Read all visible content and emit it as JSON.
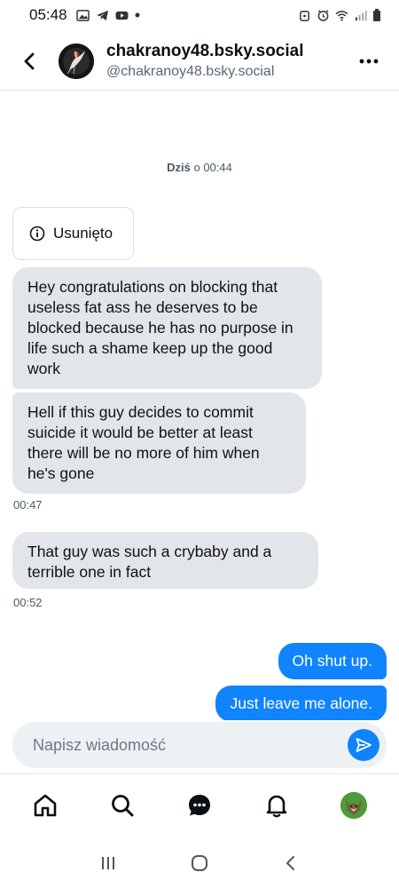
{
  "status_bar": {
    "time": "05:48",
    "left_icons": [
      "gallery-icon",
      "telegram-icon",
      "youtube-icon",
      "dot-icon"
    ],
    "right_icons": [
      "alarm-icon",
      "clock-icon",
      "wifi-icon",
      "signal-icon",
      "battery-icon"
    ]
  },
  "header": {
    "display_name": "chakranoy48.bsky.social",
    "handle": "@chakranoy48.bsky.social",
    "back_icon": "chevron-left-icon",
    "more_icon": "more-horizontal-icon"
  },
  "conversation": {
    "date_label_bold": "Dziś",
    "date_label_rest": " o 00:44",
    "deleted_label": "Usunięto",
    "messages_received": [
      {
        "text": "Hey congratulations on blocking that useless fat ass he deserves to be blocked because he has no purpose in life such a shame keep up the good work"
      },
      {
        "text": "Hell if this guy decides to commit suicide it would be better at least there will be no more of him when he's gone"
      },
      {
        "text": "That guy was such a crybaby and a terrible one in fact"
      }
    ],
    "times": [
      "00:47",
      "00:52"
    ],
    "messages_sent": [
      {
        "text": "Oh shut up."
      },
      {
        "text": "Just leave me alone."
      }
    ]
  },
  "composer": {
    "placeholder": "Napisz wiadomość",
    "value": ""
  },
  "bottom_nav": {
    "items": [
      "home-icon",
      "search-icon",
      "chat-icon",
      "bell-icon",
      "profile-avatar"
    ]
  },
  "system_nav": {
    "items": [
      "recents-icon",
      "home-circle-icon",
      "back-icon"
    ]
  },
  "colors": {
    "accent": "#1083fe",
    "received_bubble": "#e2e6ea",
    "text_secondary": "#4d5a68"
  }
}
